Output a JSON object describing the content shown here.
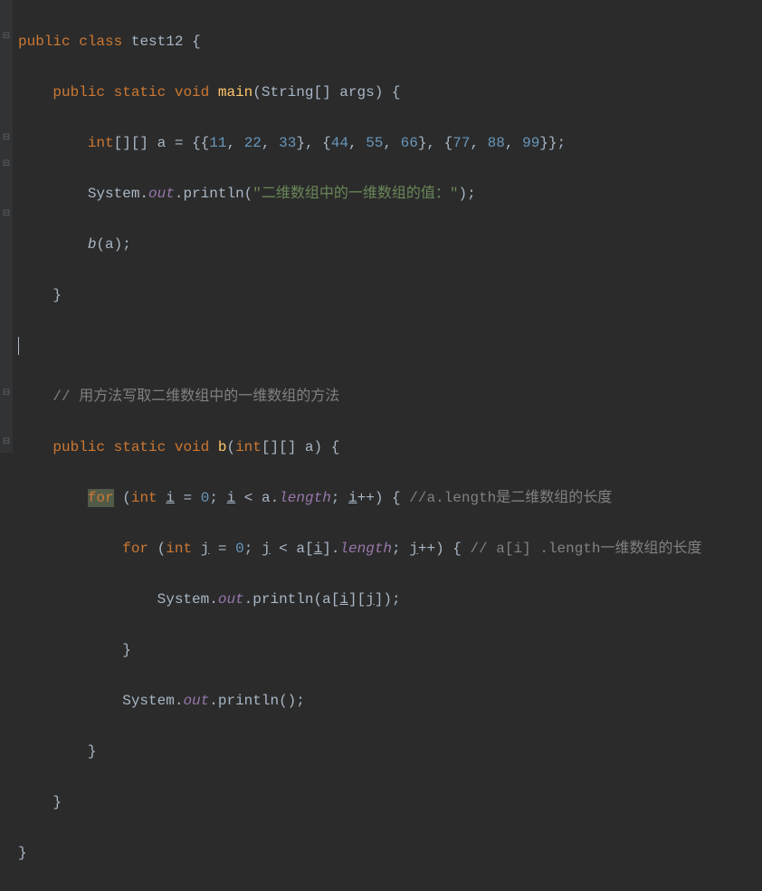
{
  "code": {
    "l1": {
      "kw_public": "public",
      "kw_class": "class",
      "class_name": "test12",
      "brace": "{"
    },
    "l2": {
      "kw_public": "public",
      "kw_static": "static",
      "kw_void": "void",
      "method_name": "main",
      "params": "(String[] args)",
      "brace": "{"
    },
    "l3": {
      "kw_int": "int",
      "brackets": "[][]",
      "var": "a",
      "eq": "=",
      "ob1": "{{",
      "n11": "11",
      "c": ",",
      "n22": "22",
      "n33": "33",
      "cb1": "}",
      "ob2": "{",
      "n44": "44",
      "n55": "55",
      "n66": "66",
      "cb2": "}",
      "ob3": "{",
      "n77": "77",
      "n88": "88",
      "n99": "99",
      "cb3": "}}",
      "semi": ";"
    },
    "l4": {
      "system": "System",
      "dot": ".",
      "out": "out",
      "println": "println",
      "open": "(",
      "str": "\"二维数组中的一维数组的值：\"",
      "close": ")",
      "semi": ";"
    },
    "l5": {
      "call": "b",
      "open": "(",
      "arg": "a",
      "close": ")",
      "semi": ";"
    },
    "l6": {
      "brace": "}"
    },
    "l8": {
      "comment": "// 用方法写取二维数组中的一维数组的方法"
    },
    "l9": {
      "kw_public": "public",
      "kw_static": "static",
      "kw_void": "void",
      "method_name": "b",
      "open": "(",
      "kw_int": "int",
      "brackets": "[][]",
      "param": "a",
      "close": ")",
      "brace": "{"
    },
    "l10": {
      "kw_for": "for",
      "open": "(",
      "kw_int": "int",
      "var_i": "i",
      "eq": "=",
      "zero": "0",
      "semi": ";",
      "lt": "<",
      "a": "a",
      "dot": ".",
      "length": "length",
      "inc": "++",
      "close": ")",
      "brace": "{",
      "comment": "//a.length是二维数组的长度"
    },
    "l11": {
      "kw_for": "for",
      "open": "(",
      "kw_int": "int",
      "var_j": "j",
      "eq": "=",
      "zero": "0",
      "semi": ";",
      "lt": "<",
      "a": "a",
      "ob": "[",
      "var_i": "i",
      "cb": "]",
      "dot": ".",
      "length": "length",
      "inc": "++",
      "close": ")",
      "brace": "{",
      "comment": "// a[i] .length一维数组的长度"
    },
    "l12": {
      "system": "System",
      "dot": ".",
      "out": "out",
      "println": "println",
      "open": "(",
      "a": "a",
      "ob1": "[",
      "var_i": "i",
      "cb1": "]",
      "ob2": "[",
      "var_j": "j",
      "cb2": "]",
      "close": ")",
      "semi": ";"
    },
    "l13": {
      "brace": "}"
    },
    "l14": {
      "system": "System",
      "dot": ".",
      "out": "out",
      "println": "println",
      "parens": "()",
      "semi": ";"
    },
    "l15": {
      "brace": "}"
    },
    "l16": {
      "brace": "}"
    },
    "l17": {
      "brace": "}"
    }
  }
}
